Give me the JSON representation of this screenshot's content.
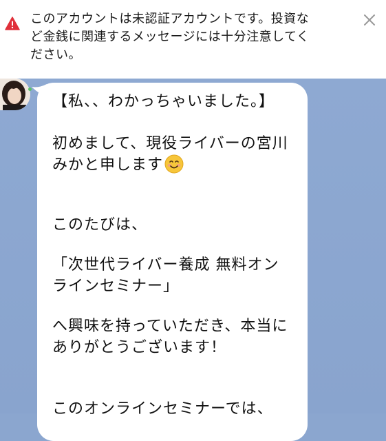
{
  "warning": {
    "message": "このアカウントは未認証アカウントです。投資など金銭に関連するメッセージには十分注意してください。",
    "lines": [
      "このアカウントは未認証アカウントです。投資な",
      "ど金銭に関連するメッセージには十分注意してく",
      "ださい。"
    ],
    "icon": "warning-triangle-icon",
    "close_icon": "close-icon",
    "icon_color": "#e0303a"
  },
  "chat": {
    "background_color": "#8ba6cf",
    "bubble_color": "#ffffff",
    "avatar_status_color": "#59c36a",
    "message_lines": [
      "【私、、わかっちゃいました。】",
      "初めまして、現役ライバーの宮川",
      "みかと申します",
      "このたびは、",
      "「次世代ライバー養成 無料オン",
      "ラインセミナー」",
      "へ興味を持っていただき、本当に",
      "ありがとうございます！",
      "このオンラインセミナーでは、"
    ],
    "emoji": "smiling-face-emoji"
  }
}
